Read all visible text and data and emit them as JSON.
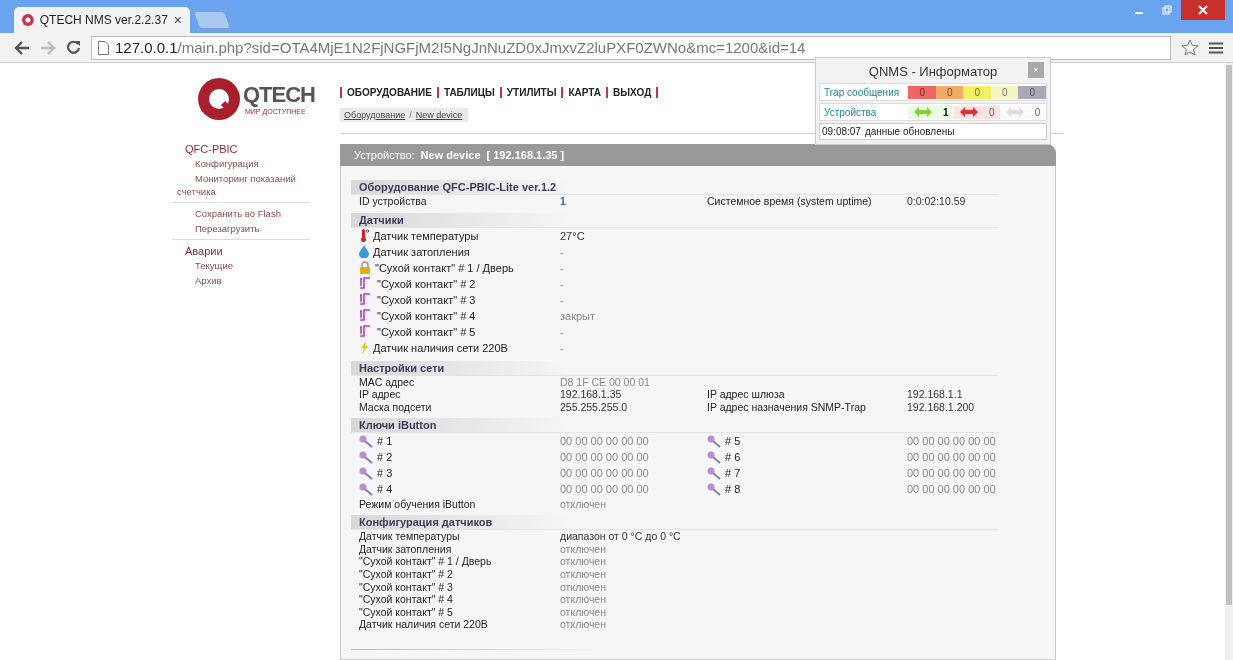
{
  "browser": {
    "tab_title": "QTECH NMS ver.2.2.37",
    "tab_close": "×",
    "url_host": "127.0.0.1",
    "url_path": "/main.php?sid=OTA4MjE1N2FjNGFjM2I5NgJnNuZD0xJmxvZ2luPXF0ZWNo&mc=1200&id=14"
  },
  "logo": {
    "name": "QTECH",
    "slogan": "МИР ДОСТУПНЕЕ"
  },
  "nav": [
    "ОБОРУДОВАНИЕ",
    "ТАБЛИЦЫ",
    "УТИЛИТЫ",
    "КАРТА",
    "ВЫХОД"
  ],
  "breadcrumb": [
    "Оборудование",
    "New device"
  ],
  "breadcrumb_separator": "/",
  "sidebar": [
    {
      "title": "QFC-PBIC",
      "items": [
        "Конфигурация",
        "Мониторинг показаний счетчика"
      ]
    },
    {
      "items": [
        "Сохранить во Flash",
        "Перезагрузить"
      ]
    },
    {
      "title": "Аварии",
      "items": [
        "Текущие",
        "Архив"
      ]
    }
  ],
  "informer": {
    "title": "QNMS - Информатор",
    "close": "×",
    "trap_label": "Trap сообщения",
    "traps": [
      {
        "value": "0",
        "color": "#f06464"
      },
      {
        "value": "0",
        "color": "#f4aa64"
      },
      {
        "value": "0",
        "color": "#f4f064"
      },
      {
        "value": "0",
        "color": "#f6f4c4"
      },
      {
        "value": "0",
        "color": "#a8a8b8"
      }
    ],
    "devices_label": "Устройства",
    "devices": [
      {
        "value": "1",
        "color": "#7ad62a"
      },
      {
        "value": "0",
        "color": "#ee2a2a"
      },
      {
        "value": "0",
        "color": "#dddddd"
      }
    ],
    "time": "09:08:07",
    "status": "данные обновлены"
  },
  "panel": {
    "label": "Устройство:",
    "device": "New device",
    "ip": "[ 192.168.1.35 ]"
  },
  "sections": [
    {
      "title": "Оборудование QFC-PBIC-Lite ver.1.2",
      "rows": [
        {
          "kind": "plain",
          "cells": [
            {
              "kind": "label",
              "text": "ID устройства"
            },
            {
              "kind": "accent",
              "text": "1"
            },
            {
              "kind": "label",
              "text": "Системное время (system uptime)"
            },
            {
              "kind": "value",
              "text": "0:0:02:10.59"
            }
          ]
        }
      ]
    },
    {
      "title": "Датчики",
      "rows": [
        {
          "kind": "thermometer",
          "cells": [
            {
              "kind": "label",
              "text": "Датчик температуры"
            },
            {
              "kind": "value",
              "text": "27°C"
            }
          ]
        },
        {
          "kind": "drop",
          "cells": [
            {
              "kind": "label",
              "text": "Датчик затопления"
            },
            {
              "kind": "muted",
              "text": "-"
            }
          ]
        },
        {
          "kind": "lock",
          "cells": [
            {
              "kind": "label",
              "text": "\"Сухой контакт\" # 1 / Дверь"
            },
            {
              "kind": "muted",
              "text": "-"
            }
          ]
        },
        {
          "kind": "contact",
          "cells": [
            {
              "kind": "label",
              "text": "\"Сухой контакт\" # 2"
            },
            {
              "kind": "muted",
              "text": "-"
            }
          ]
        },
        {
          "kind": "contact",
          "cells": [
            {
              "kind": "label",
              "text": "\"Сухой контакт\" # 3"
            },
            {
              "kind": "muted",
              "text": "-"
            }
          ]
        },
        {
          "kind": "contact",
          "cells": [
            {
              "kind": "label",
              "text": "\"Сухой контакт\" # 4"
            },
            {
              "kind": "muted",
              "text": "закрыт"
            }
          ]
        },
        {
          "kind": "contact",
          "cells": [
            {
              "kind": "label",
              "text": "\"Сухой контакт\" # 5"
            },
            {
              "kind": "muted",
              "text": "-"
            }
          ]
        },
        {
          "kind": "bolt",
          "cells": [
            {
              "kind": "label",
              "text": "Датчик наличия сети 220В"
            },
            {
              "kind": "muted",
              "text": "-"
            }
          ]
        }
      ]
    },
    {
      "title": "Настройки сети",
      "rows": [
        {
          "kind": "plain",
          "cells": [
            {
              "kind": "label",
              "text": "MAC адрес"
            },
            {
              "kind": "muted",
              "text": "D8 1F CE 00 00 01"
            }
          ]
        },
        {
          "kind": "plain",
          "cells": [
            {
              "kind": "label",
              "text": "IP адрес"
            },
            {
              "kind": "value",
              "text": "192.168.1.35"
            },
            {
              "kind": "label",
              "text": "IP адрес шлюза"
            },
            {
              "kind": "value",
              "text": "192.168.1.1"
            }
          ]
        },
        {
          "kind": "plain",
          "cells": [
            {
              "kind": "label",
              "text": "Маска подсети"
            },
            {
              "kind": "value",
              "text": "255.255.255.0"
            },
            {
              "kind": "label",
              "text": "IP адрес назначения SNMP-Trap"
            },
            {
              "kind": "value",
              "text": "192.168.1.200"
            }
          ]
        }
      ]
    },
    {
      "title": "Ключи iButton",
      "rows": [
        {
          "kind": "key",
          "cells": [
            {
              "kind": "label",
              "text": "# 1"
            },
            {
              "kind": "muted",
              "text": "00 00 00 00 00 00"
            },
            {
              "kind": "key-label",
              "text": "# 5"
            },
            {
              "kind": "muted",
              "text": "00 00 00 00 00 00"
            }
          ]
        },
        {
          "kind": "key",
          "cells": [
            {
              "kind": "label",
              "text": "# 2"
            },
            {
              "kind": "muted",
              "text": "00 00 00 00 00 00"
            },
            {
              "kind": "key-label",
              "text": "# 6"
            },
            {
              "kind": "muted",
              "text": "00 00 00 00 00 00"
            }
          ]
        },
        {
          "kind": "key",
          "cells": [
            {
              "kind": "label",
              "text": "# 3"
            },
            {
              "kind": "muted",
              "text": "00 00 00 00 00 00"
            },
            {
              "kind": "key-label",
              "text": "# 7"
            },
            {
              "kind": "muted",
              "text": "00 00 00 00 00 00"
            }
          ]
        },
        {
          "kind": "key",
          "cells": [
            {
              "kind": "label",
              "text": "# 4"
            },
            {
              "kind": "muted",
              "text": "00 00 00 00 00 00"
            },
            {
              "kind": "key-label",
              "text": "# 8"
            },
            {
              "kind": "muted",
              "text": "00 00 00 00 00 00"
            }
          ]
        },
        {
          "kind": "plain",
          "cells": [
            {
              "kind": "label",
              "text": "Режим обучения iButton"
            },
            {
              "kind": "muted",
              "text": "отключен"
            }
          ]
        }
      ]
    },
    {
      "title": "Конфигурация датчиков",
      "rows": [
        {
          "kind": "plain",
          "cells": [
            {
              "kind": "label",
              "text": "Датчик температуры"
            },
            {
              "kind": "value",
              "text": "диапазон от 0 °C до 0 °C"
            }
          ]
        },
        {
          "kind": "plain",
          "cells": [
            {
              "kind": "label",
              "text": "Датчик затопления"
            },
            {
              "kind": "muted",
              "text": "отключен"
            }
          ]
        },
        {
          "kind": "plain",
          "cells": [
            {
              "kind": "label",
              "text": "\"Сухой контакт\" # 1 / Дверь"
            },
            {
              "kind": "muted",
              "text": "отключен"
            }
          ]
        },
        {
          "kind": "plain",
          "cells": [
            {
              "kind": "label",
              "text": "\"Сухой контакт\" # 2"
            },
            {
              "kind": "muted",
              "text": "отключен"
            }
          ]
        },
        {
          "kind": "plain",
          "cells": [
            {
              "kind": "label",
              "text": "\"Сухой контакт\" # 3"
            },
            {
              "kind": "muted",
              "text": "отключен"
            }
          ]
        },
        {
          "kind": "plain",
          "cells": [
            {
              "kind": "label",
              "text": "\"Сухой контакт\" # 4"
            },
            {
              "kind": "muted",
              "text": "отключен"
            }
          ]
        },
        {
          "kind": "plain",
          "cells": [
            {
              "kind": "label",
              "text": "\"Сухой контакт\" # 5"
            },
            {
              "kind": "muted",
              "text": "отключен"
            }
          ]
        },
        {
          "kind": "plain",
          "cells": [
            {
              "kind": "label",
              "text": "Датчик наличия сети 220В"
            },
            {
              "kind": "muted",
              "text": "отключен"
            }
          ]
        }
      ]
    }
  ]
}
